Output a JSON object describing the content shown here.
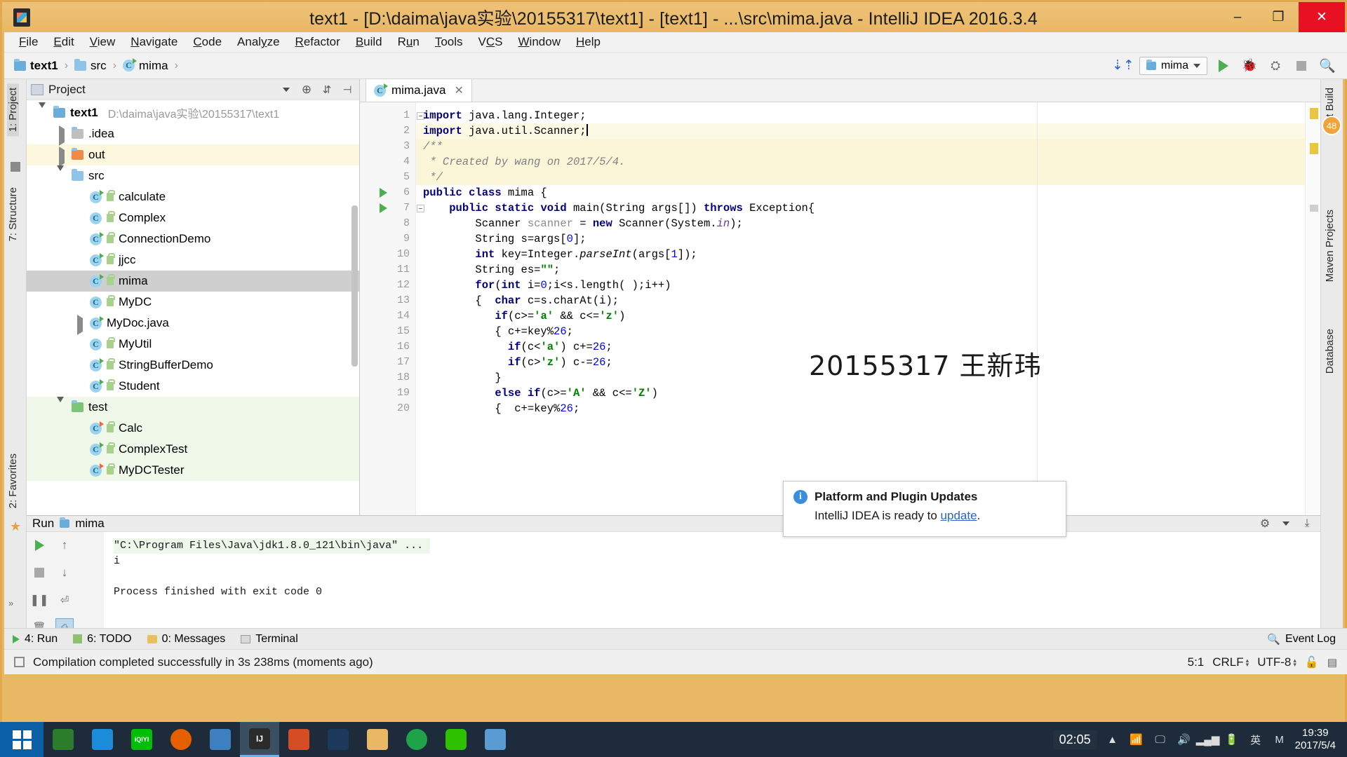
{
  "window": {
    "title": "text1 - [D:\\daima\\java实验\\20155317\\text1] - [text1] - ...\\src\\mima.java - IntelliJ IDEA 2016.3.4",
    "icon": "intellij-idea-icon",
    "minimize": "–",
    "maximize": "❐",
    "close": "✕"
  },
  "menubar": {
    "items": [
      {
        "label": "File"
      },
      {
        "label": "Edit"
      },
      {
        "label": "View"
      },
      {
        "label": "Navigate"
      },
      {
        "label": "Code"
      },
      {
        "label": "Analyze"
      },
      {
        "label": "Refactor"
      },
      {
        "label": "Build"
      },
      {
        "label": "Run"
      },
      {
        "label": "Tools"
      },
      {
        "label": "VCS"
      },
      {
        "label": "Window"
      },
      {
        "label": "Help"
      }
    ]
  },
  "navbar": {
    "breadcrumbs": [
      {
        "label": "text1",
        "icon": "project-folder-icon",
        "bold": true
      },
      {
        "label": "src",
        "icon": "folder-icon",
        "bold": false
      },
      {
        "label": "mima",
        "icon": "java-class-icon",
        "bold": false
      }
    ],
    "separator": "›",
    "run_config": "mima",
    "buttons": [
      "run-button",
      "debug-button",
      "coverage-button",
      "stop-button",
      "search-button"
    ],
    "sync_icon": "download-sync-icon"
  },
  "left_strip": {
    "tabs": [
      {
        "label": "1: Project",
        "icon": "project-icon",
        "selected": true
      },
      {
        "label": "7: Structure",
        "icon": "structure-icon",
        "selected": false
      },
      {
        "label": "2: Favorites",
        "icon": "favorites-icon",
        "selected": false
      }
    ]
  },
  "right_strip": {
    "tabs": [
      {
        "label": "Ant Build",
        "badge": "48"
      },
      {
        "label": "Maven Projects"
      },
      {
        "label": "Database"
      }
    ]
  },
  "project_panel": {
    "title": "Project",
    "header_icons": [
      "collapse-selector-icon",
      "target-icon",
      "collapse-all-icon",
      "hide-icon"
    ],
    "tree": [
      {
        "depth": 0,
        "label": "text1",
        "path": "D:\\daima\\java实验\\20155317\\text1",
        "icon": "project-folder-icon",
        "arrow": "down",
        "bold": true,
        "state": "normal"
      },
      {
        "depth": 1,
        "label": ".idea",
        "icon": "folder-grey-icon",
        "arrow": "right",
        "state": "normal"
      },
      {
        "depth": 1,
        "label": "out",
        "icon": "folder-orange-icon",
        "arrow": "right",
        "state": "highlight"
      },
      {
        "depth": 1,
        "label": "src",
        "icon": "folder-blue-icon",
        "arrow": "down",
        "state": "normal"
      },
      {
        "depth": 2,
        "label": "calculate",
        "icon": "java-class-runnable-icon",
        "lock": true,
        "state": "normal"
      },
      {
        "depth": 2,
        "label": "Complex",
        "icon": "java-class-icon",
        "lock": true,
        "state": "normal"
      },
      {
        "depth": 2,
        "label": "ConnectionDemo",
        "icon": "java-class-runnable-icon",
        "lock": true,
        "state": "normal"
      },
      {
        "depth": 2,
        "label": "jjcc",
        "icon": "java-class-runnable-icon",
        "lock": true,
        "state": "normal"
      },
      {
        "depth": 2,
        "label": "mima",
        "icon": "java-class-runnable-icon",
        "lock": true,
        "state": "selected"
      },
      {
        "depth": 2,
        "label": "MyDC",
        "icon": "java-class-icon",
        "lock": true,
        "state": "normal"
      },
      {
        "depth": 2,
        "label": "MyDoc.java",
        "icon": "java-file-icon",
        "arrow": "right",
        "state": "normal"
      },
      {
        "depth": 2,
        "label": "MyUtil",
        "icon": "java-class-icon",
        "lock": true,
        "state": "normal"
      },
      {
        "depth": 2,
        "label": "StringBufferDemo",
        "icon": "java-class-runnable-icon",
        "lock": true,
        "state": "normal"
      },
      {
        "depth": 2,
        "label": "Student",
        "icon": "java-class-runnable-icon",
        "lock": true,
        "state": "normal"
      },
      {
        "depth": 1,
        "label": "test",
        "icon": "folder-green-icon",
        "arrow": "down",
        "state": "test"
      },
      {
        "depth": 2,
        "label": "Calc",
        "icon": "java-test-class-icon",
        "lock": true,
        "state": "test"
      },
      {
        "depth": 2,
        "label": "ComplexTest",
        "icon": "java-class-runnable-icon",
        "lock": true,
        "state": "test"
      },
      {
        "depth": 2,
        "label": "MyDCTester",
        "icon": "java-test-class-icon",
        "lock": true,
        "state": "test"
      }
    ]
  },
  "editor": {
    "tab": {
      "label": "mima.java",
      "icon": "java-class-icon",
      "close": "✕"
    },
    "watermark": "20155317 王新玮",
    "lines": [
      {
        "no": "1",
        "highlight": "none",
        "runmark": false,
        "fold": true,
        "html": "<span class=\"kw\">import</span> java.lang.Integer;"
      },
      {
        "no": "2",
        "highlight": "cursor",
        "runmark": false,
        "fold": true,
        "html": "<span class=\"kw\">import</span> java.util.Scanner;<span class=\"caret\"></span>"
      },
      {
        "no": "3",
        "highlight": "comment",
        "runmark": false,
        "fold": true,
        "html": "<span class=\"cmt\">/**</span>"
      },
      {
        "no": "4",
        "highlight": "comment",
        "runmark": false,
        "fold": false,
        "html": " <span class=\"cmt\">* Created by wang on 2017/5/4.</span>"
      },
      {
        "no": "5",
        "highlight": "comment",
        "runmark": false,
        "fold": true,
        "html": " <span class=\"cmt\">*/</span>"
      },
      {
        "no": "6",
        "highlight": "none",
        "runmark": true,
        "fold": false,
        "html": "<span class=\"kw\">public class</span> mima {"
      },
      {
        "no": "7",
        "highlight": "none",
        "runmark": true,
        "fold": true,
        "html": "    <span class=\"kw\">public static void</span> main(String args[]) <span class=\"kw\">throws</span> Exception{"
      },
      {
        "no": "8",
        "highlight": "none",
        "runmark": false,
        "fold": false,
        "html": "        Scanner <span class=\"grey\">scanner</span> = <span class=\"kw\">new</span> Scanner(System.<span class=\"fld ital\">in</span>);"
      },
      {
        "no": "9",
        "highlight": "none",
        "runmark": false,
        "fold": false,
        "html": "        String s=args[<span class=\"num\">0</span>];"
      },
      {
        "no": "10",
        "highlight": "none",
        "runmark": false,
        "fold": false,
        "html": "        <span class=\"kw\">int</span> key=Integer.<span class=\"ital\">parseInt</span>(args[<span class=\"num\">1</span>]);"
      },
      {
        "no": "11",
        "highlight": "none",
        "runmark": false,
        "fold": false,
        "html": "        String es=<span class=\"str\">\"\"</span>;"
      },
      {
        "no": "12",
        "highlight": "none",
        "runmark": false,
        "fold": false,
        "html": "        <span class=\"kw\">for</span>(<span class=\"kw\">int</span> i=<span class=\"num\">0</span>;i&lt;s.length( );i++)"
      },
      {
        "no": "13",
        "highlight": "none",
        "runmark": false,
        "fold": false,
        "html": "        {  <span class=\"kw\">char</span> c=s.charAt(i);"
      },
      {
        "no": "14",
        "highlight": "none",
        "runmark": false,
        "fold": false,
        "html": "           <span class=\"kw\">if</span>(c&gt;=<span class=\"str\">'a'</span> &amp;&amp; c&lt;=<span class=\"str\">'z'</span>)"
      },
      {
        "no": "15",
        "highlight": "none",
        "runmark": false,
        "fold": false,
        "html": "           { c+=key%<span class=\"num\">26</span>;"
      },
      {
        "no": "16",
        "highlight": "none",
        "runmark": false,
        "fold": false,
        "html": "             <span class=\"kw\">if</span>(c&lt;<span class=\"str\">'a'</span>) c+=<span class=\"num\">26</span>;"
      },
      {
        "no": "17",
        "highlight": "none",
        "runmark": false,
        "fold": false,
        "html": "             <span class=\"kw\">if</span>(c&gt;<span class=\"str\">'z'</span>) c-=<span class=\"num\">26</span>;"
      },
      {
        "no": "18",
        "highlight": "none",
        "runmark": false,
        "fold": false,
        "html": "           }"
      },
      {
        "no": "19",
        "highlight": "none",
        "runmark": false,
        "fold": false,
        "html": "           <span class=\"kw\">else if</span>(c&gt;=<span class=\"str\">'A'</span> &amp;&amp; c&lt;=<span class=\"str\">'Z'</span>)"
      },
      {
        "no": "20",
        "highlight": "none",
        "runmark": false,
        "fold": false,
        "html": "           {  c+=key%<span class=\"num\">26</span>;"
      }
    ]
  },
  "run_panel": {
    "header": {
      "label": "Run",
      "config": "mima",
      "icon": "run-config-icon",
      "settings_icon": "gear-icon",
      "export_icon": "export-icon"
    },
    "toolbar_icons": [
      "rerun-button",
      "stop-button",
      "pause-button",
      "trash-button",
      "scroll-up-button",
      "scroll-down-button",
      "soft-wrap-button",
      "print-button"
    ],
    "console": [
      {
        "text": "\"C:\\Program Files\\Java\\jdk1.8.0_121\\bin\\java\" ...",
        "highlight": true
      },
      {
        "text": "i",
        "highlight": false
      },
      {
        "text": "",
        "highlight": false
      },
      {
        "text": "Process finished with exit code 0",
        "highlight": false
      }
    ]
  },
  "notification": {
    "icon": "info-icon",
    "title": "Platform and Plugin Updates",
    "body_prefix": "IntelliJ IDEA is ready to ",
    "link": "update",
    "body_suffix": "."
  },
  "bottom_tabs": {
    "items": [
      {
        "label": "4: Run",
        "icon": "run-icon",
        "underline": "4"
      },
      {
        "label": "6: TODO",
        "icon": "todo-icon",
        "underline": "6"
      },
      {
        "label": "0: Messages",
        "icon": "messages-icon",
        "underline": "0"
      },
      {
        "label": "Terminal",
        "icon": "terminal-icon",
        "underline": ""
      }
    ],
    "event_log": "Event Log",
    "event_log_icon": "event-log-icon"
  },
  "statusbar": {
    "message": "Compilation completed successfully in 3s 238ms (moments ago)",
    "caret_position": "5:1",
    "line_separator": "CRLF",
    "encoding": "UTF-8",
    "lock_icon": "unlocked-icon",
    "notify_icon": "notification-icon",
    "status_icon": "build-status-icon"
  },
  "taskbar": {
    "start": "windows-start-icon",
    "apps": [
      {
        "name": "folder-app-icon",
        "label": "",
        "color": "#2b7d2b",
        "active": false
      },
      {
        "name": "store-app-icon",
        "label": "",
        "color": "#1a8cd8",
        "active": false
      },
      {
        "name": "iqiyi-app-icon",
        "label": "iQIYI",
        "color": "#00be06",
        "active": false
      },
      {
        "name": "firefox-app-icon",
        "label": "",
        "color": "#e66000",
        "active": false
      },
      {
        "name": "blue-app-icon",
        "label": "",
        "color": "#3d7fbf",
        "active": false
      },
      {
        "name": "intellij-app-icon",
        "label": "IJ",
        "color": "#2b2b2b",
        "active": true
      },
      {
        "name": "windows-app-icon",
        "label": "",
        "color": "#d64d24",
        "active": false
      },
      {
        "name": "game-app-icon",
        "label": "",
        "color": "#1b3a5c",
        "active": false
      },
      {
        "name": "explorer-app-icon",
        "label": "",
        "color": "#e8b864",
        "active": false
      },
      {
        "name": "browser-app-icon",
        "label": "",
        "color": "#1fa34a",
        "active": false
      },
      {
        "name": "wechat-app-icon",
        "label": "",
        "color": "#2dc100",
        "active": false
      },
      {
        "name": "notes-app-icon",
        "label": "",
        "color": "#5a9bd4",
        "active": false
      }
    ],
    "battery_time": "02:05",
    "tray_icons": [
      "show-hidden-icon",
      "network-icon",
      "screen-icon",
      "volume-icon",
      "signal-icon",
      "battery-icon"
    ],
    "ime": "英",
    "ime2": "M",
    "clock_time": "19:39",
    "clock_date": "2017/5/4"
  }
}
